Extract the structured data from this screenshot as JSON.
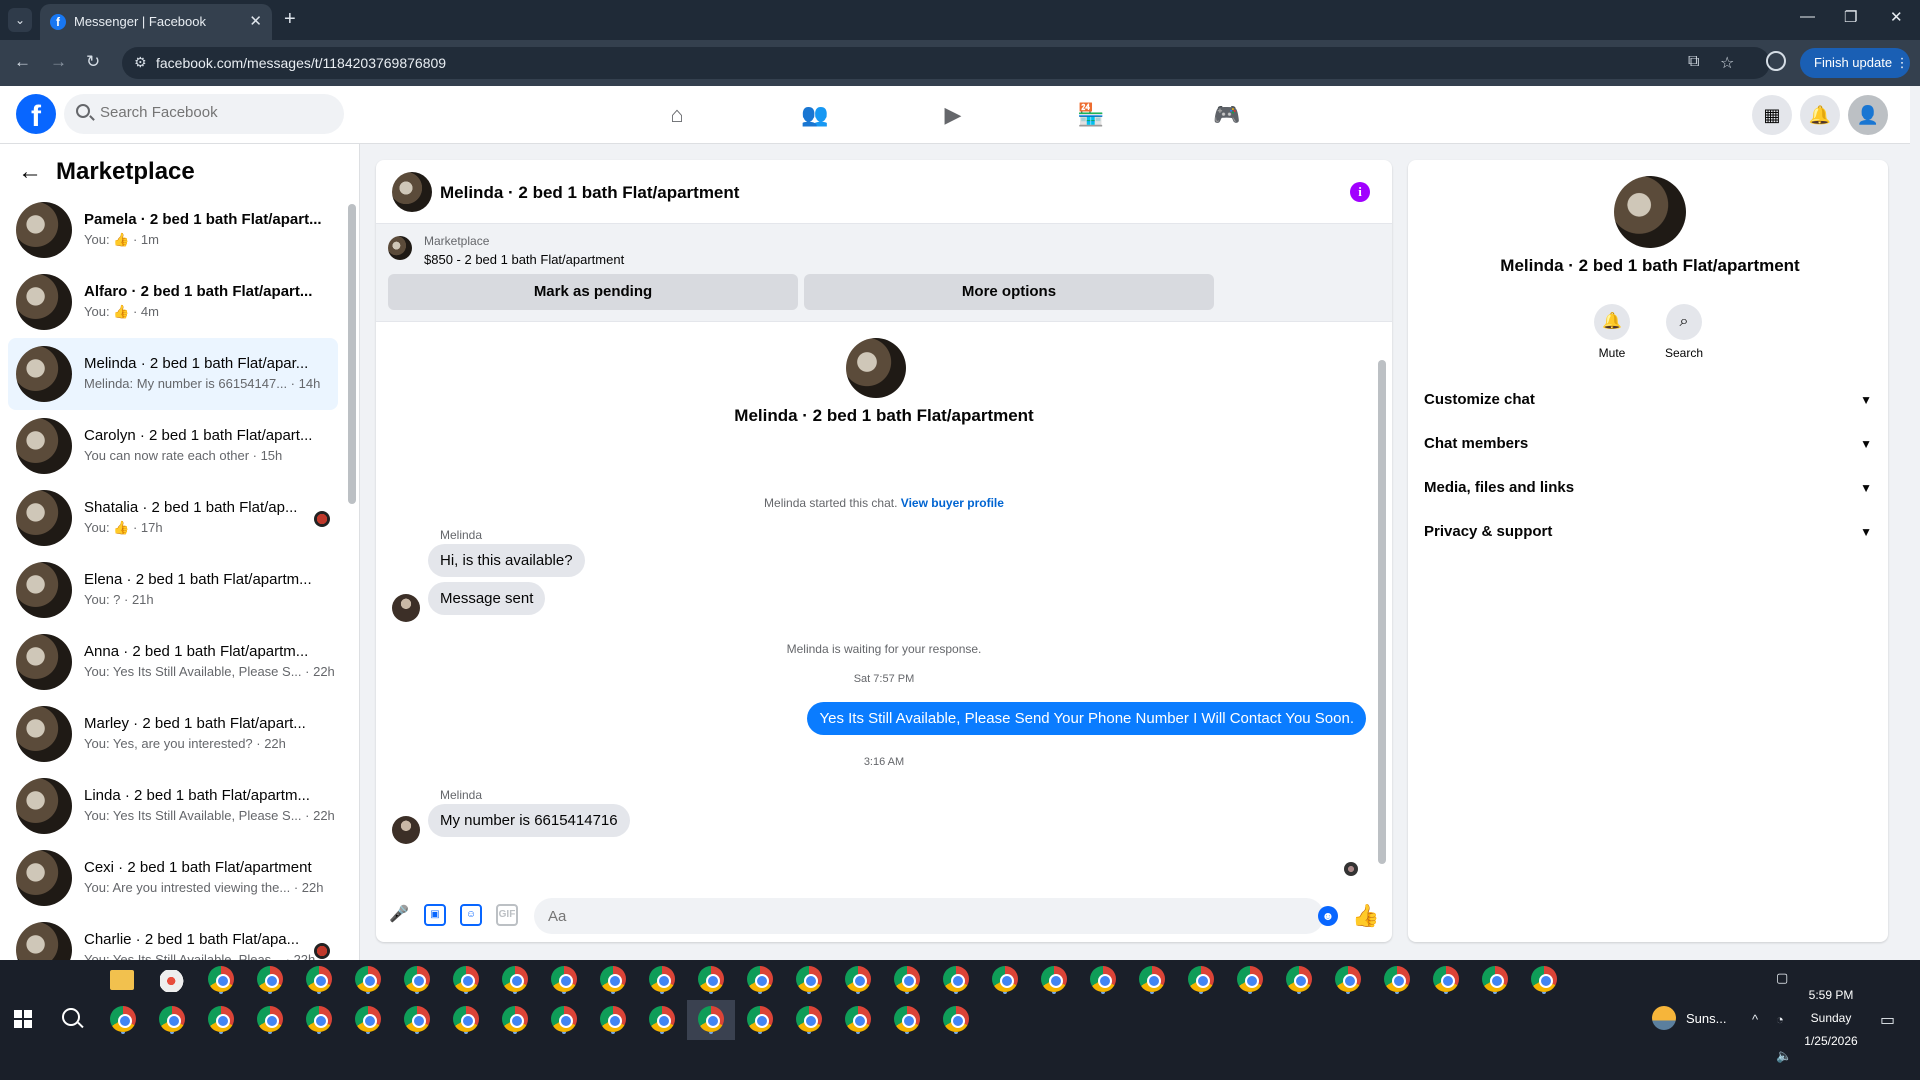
{
  "browser": {
    "tab_title": "Messenger | Facebook",
    "url": "facebook.com/messages/t/1184203769876809",
    "finish_update": "Finish update"
  },
  "fbnav": {
    "search_placeholder": "Search Facebook"
  },
  "left": {
    "title": "Marketplace",
    "conversations": [
      {
        "name": "Pamela · 2 bed 1 bath Flat/apart...",
        "sub": "You: 👍 · 1m",
        "bold": true
      },
      {
        "name": "Alfaro · 2 bed 1 bath Flat/apart...",
        "sub": "You: 👍 · 4m",
        "bold": true
      },
      {
        "name": "Melinda · 2 bed 1 bath Flat/apar...",
        "sub": "Melinda: My number is 66154147... · 14h",
        "bold": false,
        "active": true
      },
      {
        "name": "Carolyn · 2 bed 1 bath Flat/apart...",
        "sub": "You can now rate each other · 15h",
        "bold": false
      },
      {
        "name": "Shatalia · 2 bed 1 bath Flat/ap...",
        "sub": "You: 👍 · 17h",
        "bold": false,
        "dot": true
      },
      {
        "name": "Elena · 2 bed 1 bath Flat/apartm...",
        "sub": "You: ? · 21h",
        "bold": false
      },
      {
        "name": "Anna · 2 bed 1 bath Flat/apartm...",
        "sub": "You: Yes Its Still Available, Please S... · 22h",
        "bold": false
      },
      {
        "name": "Marley · 2 bed 1 bath Flat/apart...",
        "sub": "You: Yes, are you interested? · 22h",
        "bold": false
      },
      {
        "name": "Linda · 2 bed 1 bath Flat/apartm...",
        "sub": "You: Yes Its Still Available, Please S... · 22h",
        "bold": false
      },
      {
        "name": "Cexi · 2 bed 1 bath Flat/apartment",
        "sub": "You: Are you intrested viewing the... · 22h",
        "bold": false
      },
      {
        "name": "Charlie · 2 bed 1 bath Flat/apa...",
        "sub": "You: Yes Its Still Available, Pleas... · 22h",
        "bold": false,
        "dot": true
      }
    ]
  },
  "chat": {
    "title": "Melinda · 2 bed 1 bath Flat/apartment",
    "marketplace_label": "Marketplace",
    "listing": "$850 - 2 bed 1 bath Flat/apartment",
    "mark_pending": "Mark as pending",
    "more_options": "More options",
    "header_name": "Melinda · 2 bed 1 bath Flat/apartment",
    "started_text": "Melinda started this chat.",
    "view_buyer_profile": "View buyer profile",
    "sender1": "Melinda",
    "msg1": "Hi, is this available?",
    "msg2": "Message sent",
    "waiting": "Melinda is waiting for your response.",
    "time1": "Sat 7:57 PM",
    "my_msg": "Yes Its Still Available, Please Send Your Phone Number I Will Contact You Soon.",
    "time2": "3:16 AM",
    "sender2": "Melinda",
    "msg3": "My number is 6615414716",
    "composer_placeholder": "Aa"
  },
  "right": {
    "name": "Melinda · 2 bed 1 bath Flat/apartment",
    "mute": "Mute",
    "search": "Search",
    "sections": [
      "Customize chat",
      "Chat members",
      "Media, files and links",
      "Privacy & support"
    ]
  },
  "taskbar": {
    "weather": "Suns...",
    "time": "5:59 PM",
    "day": "Sunday",
    "date": "1/25/2026"
  },
  "colors": {
    "fb_blue": "#0866ff",
    "my_bubble": "#0a7cff",
    "active_conv": "#ebf5ff",
    "info_icon": "#a100ff"
  }
}
